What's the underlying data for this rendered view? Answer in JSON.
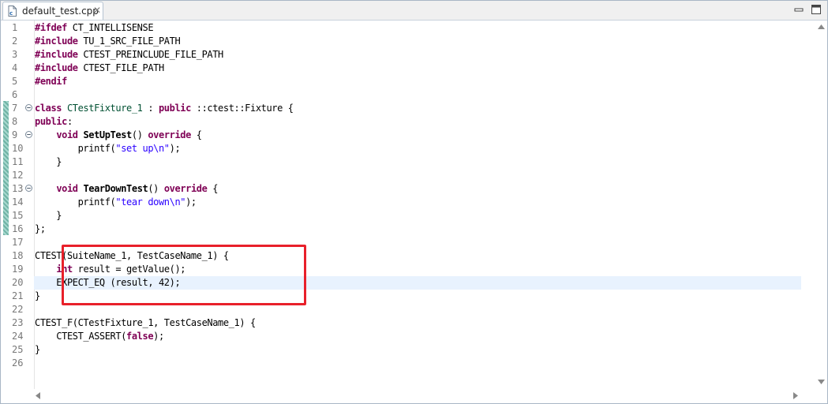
{
  "tab": {
    "title": "default_test.cpp",
    "close": "✕"
  },
  "colors": {
    "keyword": "#7f0055",
    "string": "#2a00ff",
    "class": "#005032",
    "highlight": "#e8f2fe",
    "annotation": "#e8202a"
  },
  "editor": {
    "lines": [
      {
        "n": "1",
        "html": "<span class='pp'>#ifdef</span> CT_INTELLISENSE"
      },
      {
        "n": "2",
        "html": "<span class='pp'>#include</span> TU_1_SRC_FILE_PATH"
      },
      {
        "n": "3",
        "html": "<span class='pp'>#include</span> CTEST_PREINCLUDE_FILE_PATH"
      },
      {
        "n": "4",
        "html": "<span class='pp'>#include</span> CTEST_FILE_PATH"
      },
      {
        "n": "5",
        "html": "<span class='pp'>#endif</span>"
      },
      {
        "n": "6",
        "html": ""
      },
      {
        "n": "7",
        "html": "<span class='kw'>class</span> <span class='cls'>CTestFixture_1</span> : <span class='kw'>public</span> ::ctest::Fixture {",
        "fold": true
      },
      {
        "n": "8",
        "html": "<span class='kw'>public</span>:"
      },
      {
        "n": "9",
        "html": "    <span class='kw'>void</span> <span class='fn'>SetUpTest</span>() <span class='kw'>override</span> {",
        "fold": true
      },
      {
        "n": "10",
        "html": "        printf(<span class='str'>\"set up\\n\"</span>);"
      },
      {
        "n": "11",
        "html": "    }"
      },
      {
        "n": "12",
        "html": ""
      },
      {
        "n": "13",
        "html": "    <span class='kw'>void</span> <span class='fn'>TearDownTest</span>() <span class='kw'>override</span> {",
        "fold": true
      },
      {
        "n": "14",
        "html": "        printf(<span class='str'>\"tear down\\n\"</span>);"
      },
      {
        "n": "15",
        "html": "    }"
      },
      {
        "n": "16",
        "html": "};"
      },
      {
        "n": "17",
        "html": ""
      },
      {
        "n": "18",
        "html": "CTEST(SuiteName_1, TestCaseName_1) {"
      },
      {
        "n": "19",
        "html": "    <span class='kw'>int</span> result = getValue();"
      },
      {
        "n": "20",
        "html": "    EXPECT_EQ (result, 42);",
        "current": true
      },
      {
        "n": "21",
        "html": "}"
      },
      {
        "n": "22",
        "html": ""
      },
      {
        "n": "23",
        "html": "CTEST_F(CTestFixture_1, TestCaseName_1) {"
      },
      {
        "n": "24",
        "html": "    CTEST_ASSERT(<span class='kw'>false</span>);"
      },
      {
        "n": "25",
        "html": "}"
      },
      {
        "n": "26",
        "html": ""
      }
    ]
  }
}
